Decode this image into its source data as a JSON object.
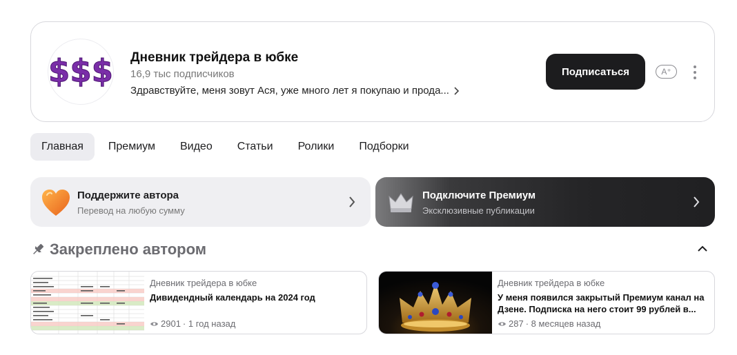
{
  "channel": {
    "avatar_text": "$$$",
    "title": "Дневник трейдера в юбке",
    "subscribers": "16,9 тыс подписчиков",
    "description": "Здравствуйте, меня зовут Ася, уже много лет я покупаю и прода...",
    "subscribe_label": "Подписаться",
    "font_size_label": "A⁺"
  },
  "tabs": [
    {
      "label": "Главная",
      "active": true
    },
    {
      "label": "Премиум"
    },
    {
      "label": "Видео"
    },
    {
      "label": "Статьи"
    },
    {
      "label": "Ролики"
    },
    {
      "label": "Подборки"
    }
  ],
  "promo": {
    "support": {
      "title": "Поддержите автора",
      "subtitle": "Перевод на любую сумму"
    },
    "premium": {
      "title": "Подключите Премиум",
      "subtitle": "Эксклюзивные публикации"
    }
  },
  "pinned": {
    "title": "Закреплено автором",
    "articles": [
      {
        "author": "Дневник трейдера в юбке",
        "title": "Дивидендный календарь на 2024 год",
        "views": "2901",
        "age": " · 1 год назад"
      },
      {
        "author": "Дневник трейдера в юбке",
        "title": "У меня появился закрытый Премиум канал на Дзене. Подписка на него стоит 99 рублей в...",
        "views": "287",
        "age": " · 8 месяцев назад"
      }
    ]
  },
  "colors": {
    "avatar_purple": "#7a2ea8",
    "button_dark": "#1c1c1e",
    "tab_active_bg": "#ececf0",
    "heart_orange": "#f5892a"
  },
  "icons": [
    "chevron-right-icon",
    "font-size-icon",
    "more-vertical-icon",
    "heart-icon",
    "crown-icon",
    "pin-icon",
    "chevron-up-icon",
    "eye-icon"
  ]
}
